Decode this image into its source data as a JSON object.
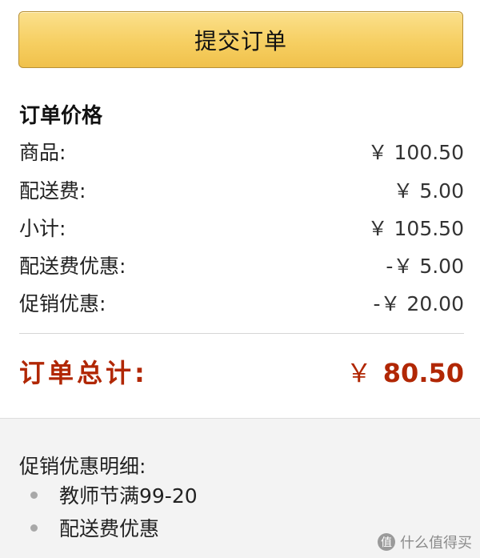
{
  "submit_button": {
    "label": "提交订单"
  },
  "order_price": {
    "title": "订单价格",
    "rows": [
      {
        "label": "商品:",
        "value": "￥ 100.50"
      },
      {
        "label": "配送费:",
        "value": "￥ 5.00"
      },
      {
        "label": "小计:",
        "value": "￥ 105.50"
      },
      {
        "label": "配送费优惠:",
        "value": "-￥ 5.00"
      },
      {
        "label": "促销优惠:",
        "value": "-￥ 20.00"
      }
    ],
    "total": {
      "label": "订单总计:",
      "currency": "￥",
      "amount": "80.50"
    }
  },
  "promo_details": {
    "title": "促销优惠明细:",
    "items": [
      "教师节满99-20",
      "配送费优惠"
    ]
  },
  "watermark": {
    "icon": "值",
    "text": "什么值得买"
  },
  "colors": {
    "button": "#f0c14b",
    "total": "#b12704",
    "bottom_bg": "#f3f3f3"
  }
}
